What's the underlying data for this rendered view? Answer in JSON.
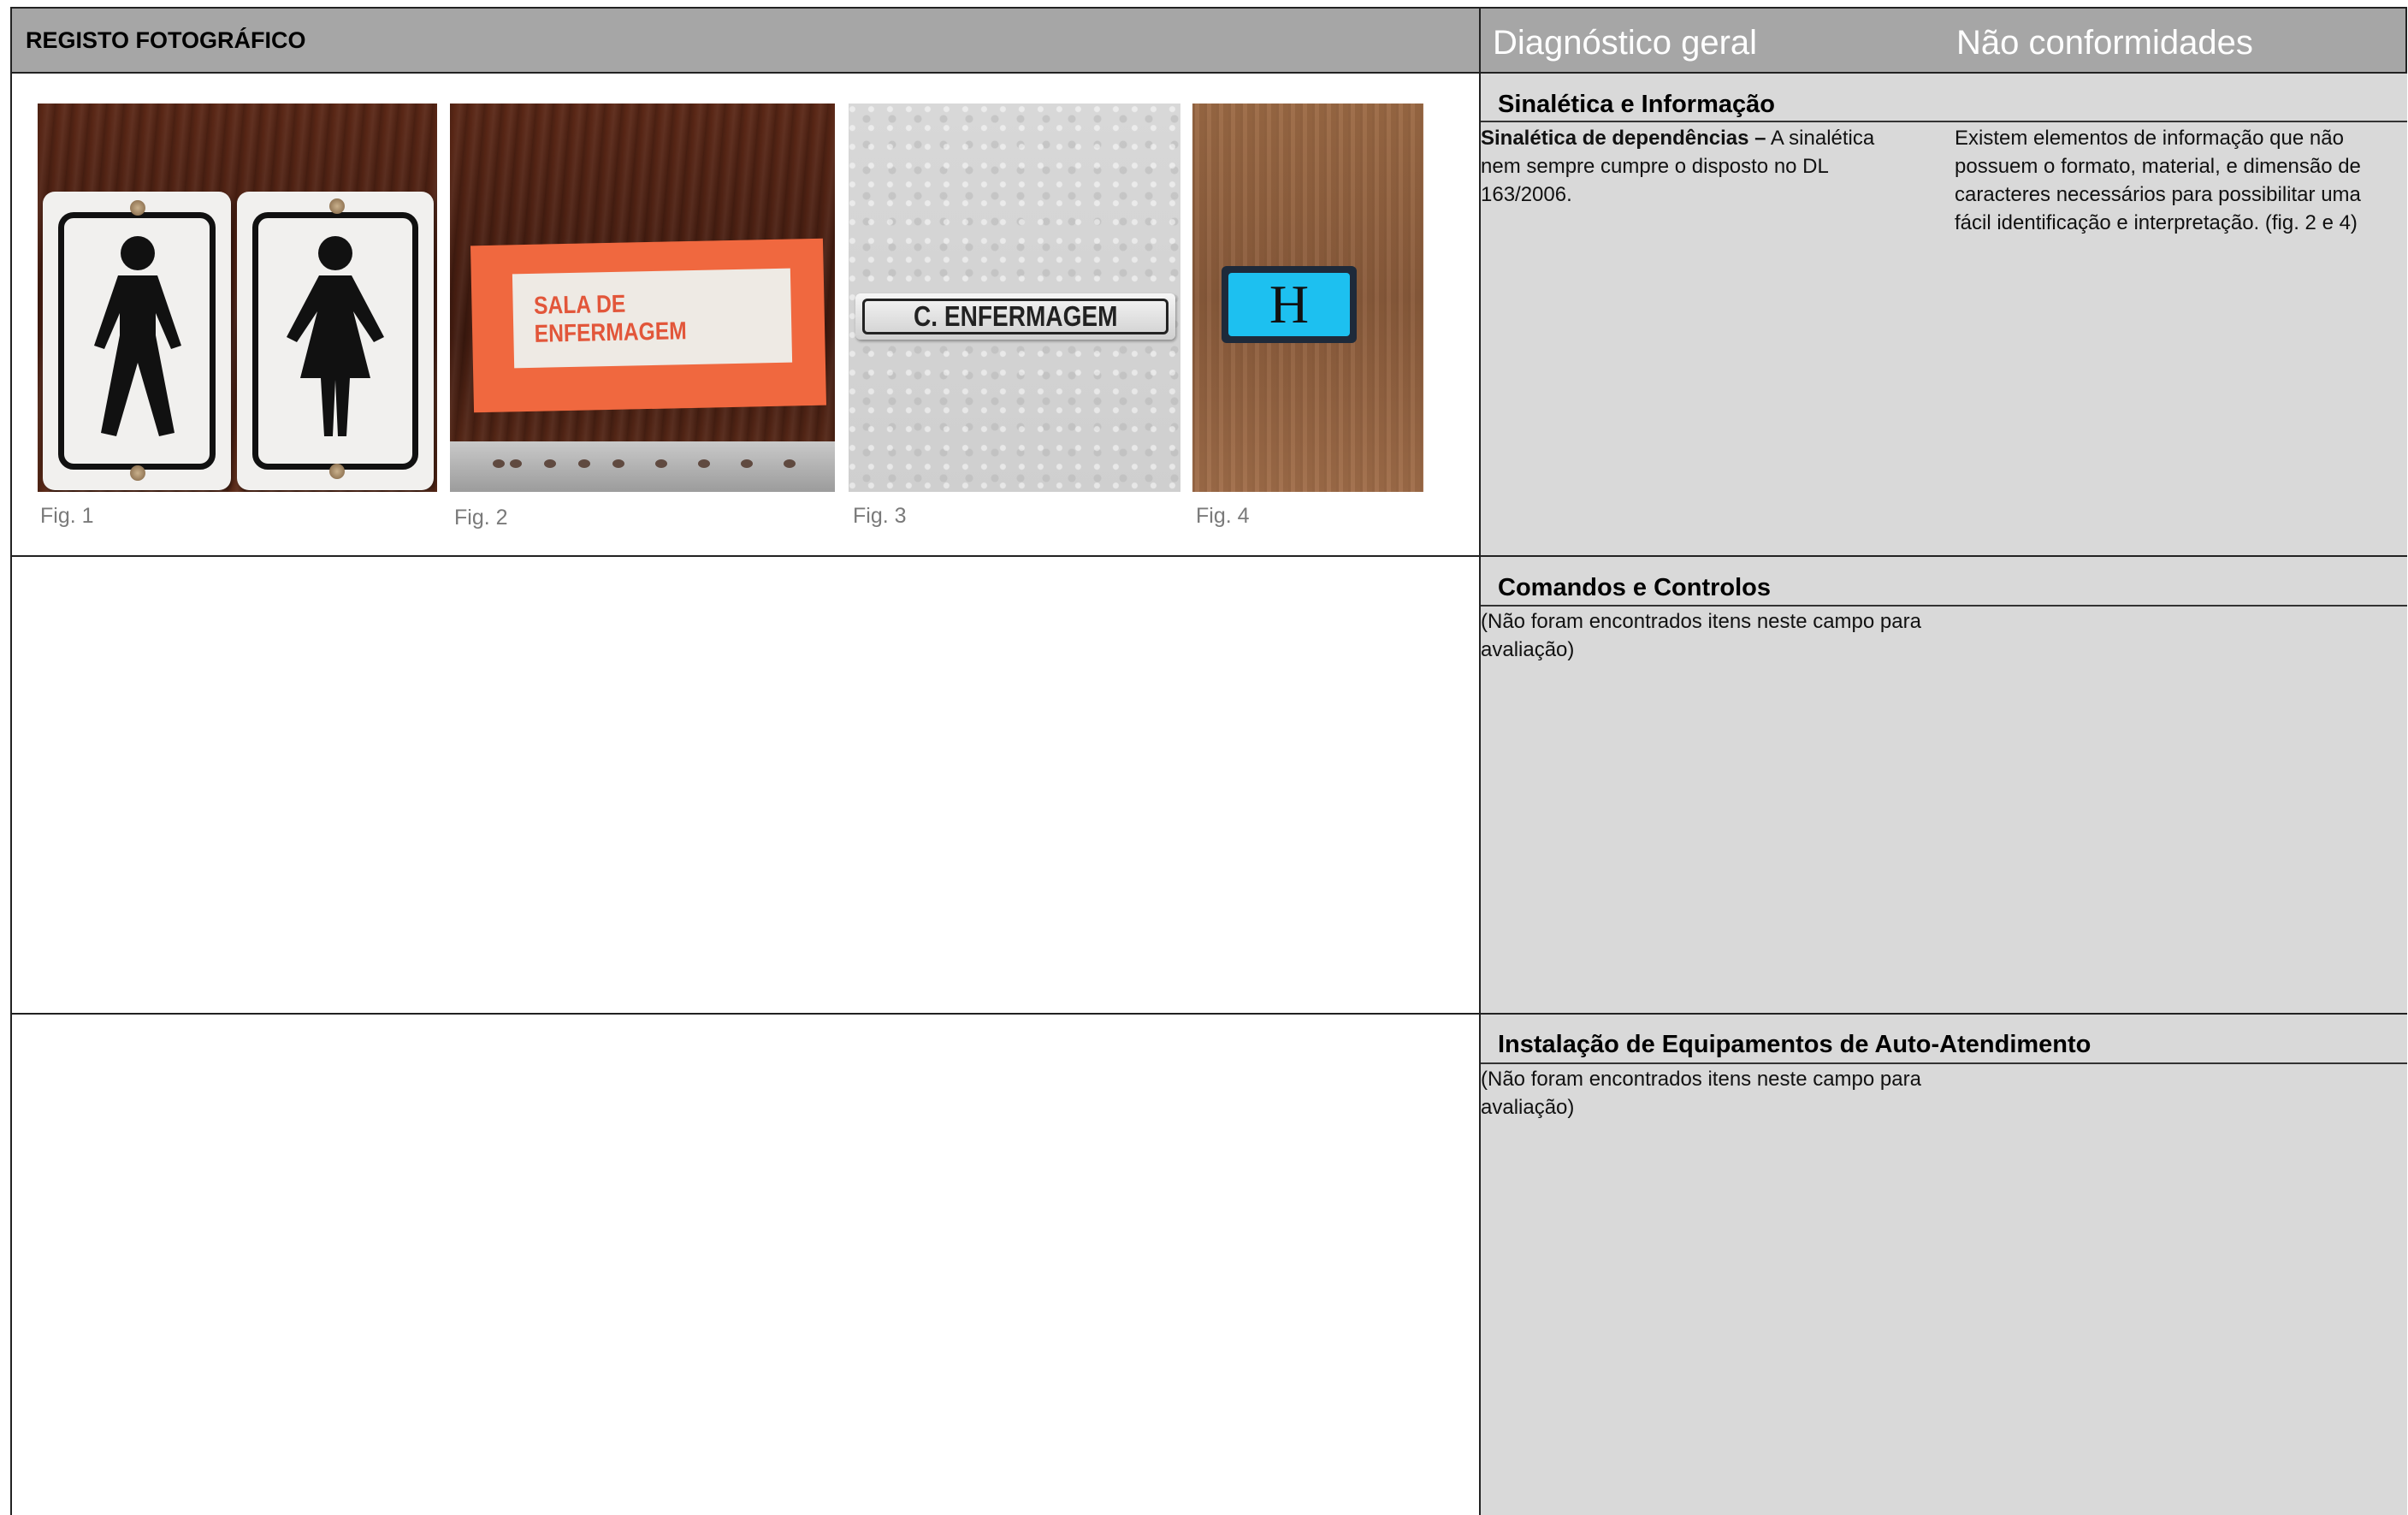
{
  "header": {
    "left_title": "REGISTO FOTOGRÁFICO",
    "col_diagnostico": "Diagnóstico geral",
    "col_nao_conformidades": "Não conformidades"
  },
  "figures": [
    {
      "caption": "Fig. 1"
    },
    {
      "caption": "Fig. 2",
      "sign_text": "SALA DE ENFERMAGEM"
    },
    {
      "caption": "Fig. 3",
      "sign_text": "C. ENFERMAGEM"
    },
    {
      "caption": "Fig. 4",
      "sign_text": "H"
    }
  ],
  "sections": [
    {
      "title": "Sinalética e Informação",
      "diag_bold": "Sinalética de dependências –",
      "diag_text": " A sinalética nem sempre cumpre o disposto no DL 163/2006.",
      "nc_text": "Existem elementos de informação que não possuem o formato, material, e dimensão de caracteres necessários para possibilitar uma fácil identificação e interpretação. (fig. 2 e 4)"
    },
    {
      "title": "Comandos e Controlos",
      "diag_text": "(Não foram encontrados itens neste campo para avaliação)"
    },
    {
      "title": "Instalação de Equipamentos de Auto-Atendimento",
      "diag_text": "(Não foram encontrados itens neste campo para avaliação)"
    }
  ]
}
